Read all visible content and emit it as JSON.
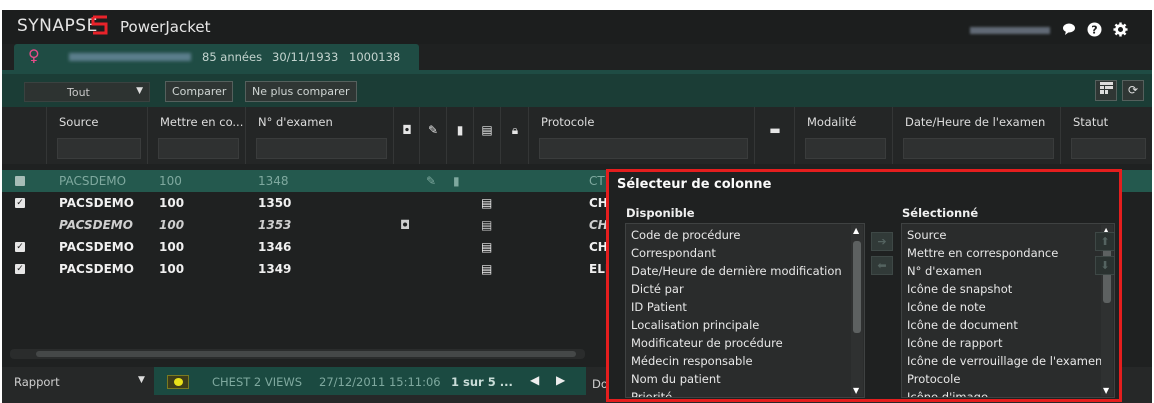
{
  "app": {
    "brand": "SYNAPSE",
    "product": "PowerJacket"
  },
  "header_icons": [
    "chat-icon",
    "help-icon",
    "gear-icon"
  ],
  "patient": {
    "age": "85 années",
    "dob": "30/11/1933",
    "id": "1000138"
  },
  "toolbar": {
    "filter_value": "Tout",
    "compare_label": "Comparer",
    "stop_compare_label": "Ne plus comparer"
  },
  "columns": {
    "source": "Source",
    "match": "Mettre en co...",
    "exam_no": "N° d'examen",
    "protocol": "Protocole",
    "modality": "Modalité",
    "exam_datetime": "Date/Heure de l'examen",
    "status": "Statut"
  },
  "rows": [
    {
      "source": "PACSDEMO",
      "match": "100",
      "exam_no": "1348",
      "protocol": "CT",
      "checked": true,
      "selected": true
    },
    {
      "source": "PACSDEMO",
      "match": "100",
      "exam_no": "1350",
      "protocol": "CH",
      "checked": true
    },
    {
      "source": "PACSDEMO",
      "match": "100",
      "exam_no": "1353",
      "protocol": "CH",
      "checked": false
    },
    {
      "source": "PACSDEMO",
      "match": "100",
      "exam_no": "1346",
      "protocol": "CH",
      "checked": true
    },
    {
      "source": "PACSDEMO",
      "match": "100",
      "exam_no": "1349",
      "protocol": "ELE",
      "checked": true
    }
  ],
  "report_bar": {
    "label": "Rapport",
    "title": "CHEST 2 VIEWS",
    "date": "27/12/2011 15:11:06",
    "page": "1 sur 5 ...",
    "side_label": "Do"
  },
  "column_selector": {
    "title": "Sélecteur de colonne",
    "available_label": "Disponible",
    "selected_label": "Sélectionné",
    "available": [
      "Code de procédure",
      "Correspondant",
      "Date/Heure de dernière modification",
      "Dicté par",
      "ID Patient",
      "Localisation principale",
      "Modificateur de procédure",
      "Médecin responsable",
      "Nom du patient",
      "Priorité"
    ],
    "selected": [
      "Source",
      "Mettre en correspondance",
      "N° d'examen",
      "Icône de snapshot",
      "Icône de note",
      "Icône de document",
      "Icône de rapport",
      "Icône de verrouillage de l'examen",
      "Protocole",
      "Icône d'image"
    ]
  }
}
